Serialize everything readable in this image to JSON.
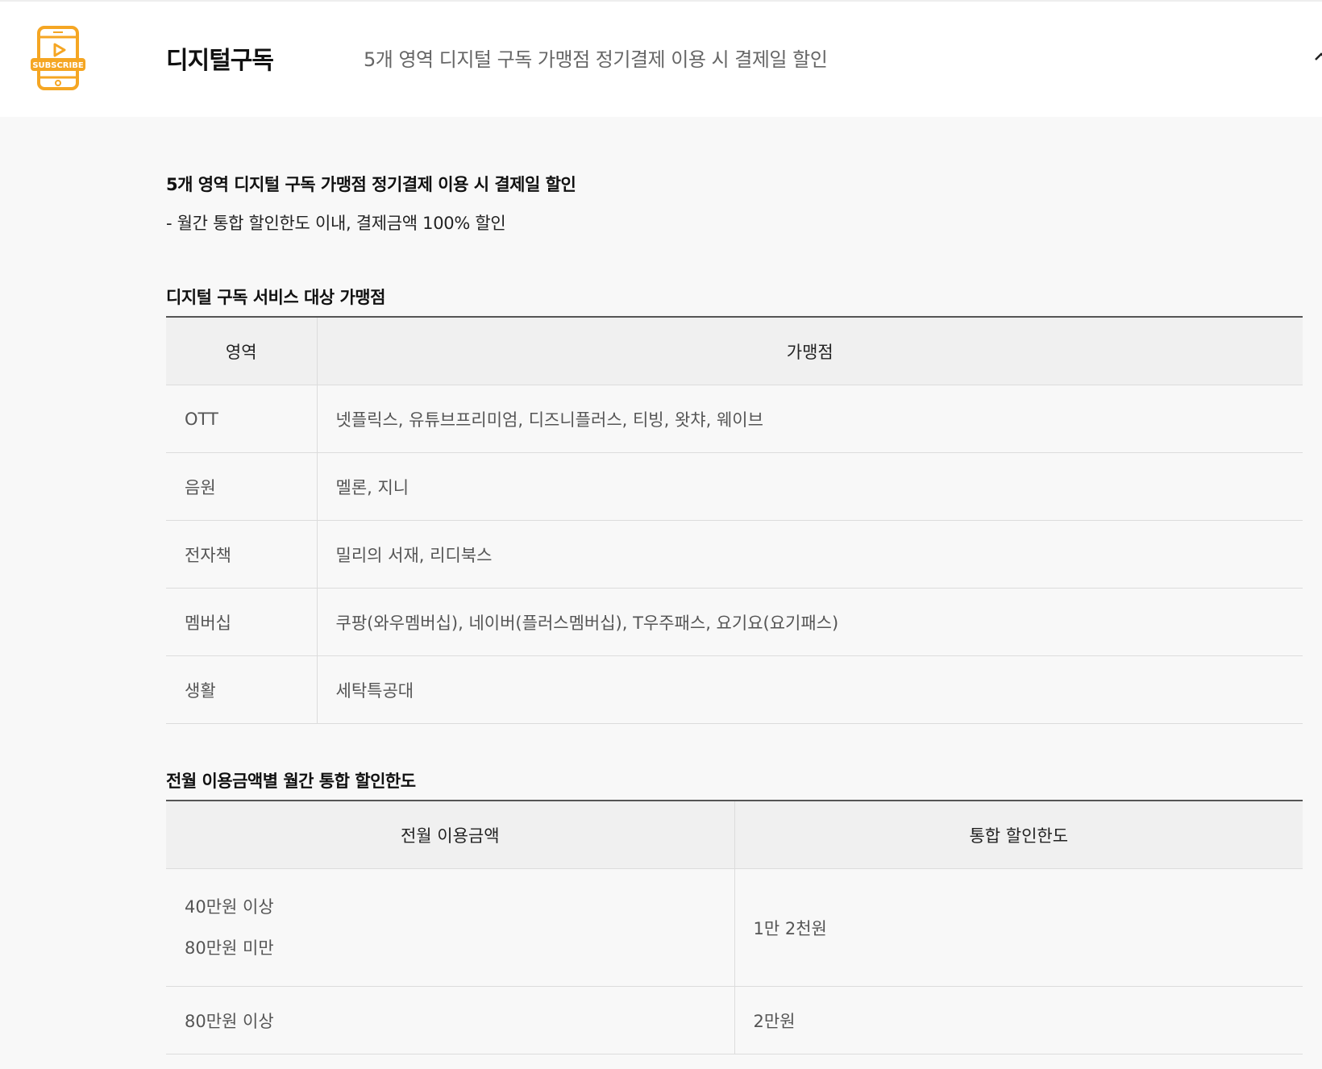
{
  "header": {
    "title": "디지털구독",
    "description": "5개 영역 디지털 구독 가맹점 정기결제 이용 시 결제일 할인",
    "logo_text": "SUBSCRIBE",
    "logo_icon": "subscribe-phone-icon",
    "collapse_icon": "chevron-up-icon",
    "accent_color": "#f5a623"
  },
  "summary": {
    "title": "5개 영역 디지털 구독 가맹점 정기결제 이용 시 결제일 할인",
    "desc": "- 월간 통합 할인한도 이내, 결제금액 100% 할인"
  },
  "merchants": {
    "title": "디지털 구독 서비스 대상 가맹점",
    "headers": [
      "영역",
      "가맹점"
    ],
    "rows": [
      {
        "area": "OTT",
        "stores": "넷플릭스, 유튜브프리미엄, 디즈니플러스, 티빙, 왓챠, 웨이브"
      },
      {
        "area": "음원",
        "stores": "멜론, 지니"
      },
      {
        "area": "전자책",
        "stores": "밀리의 서재, 리디북스"
      },
      {
        "area": "멤버십",
        "stores": "쿠팡(와우멤버십), 네이버(플러스멤버십), T우주패스, 요기요(요기패스)"
      },
      {
        "area": "생활",
        "stores": "세탁특공대"
      }
    ]
  },
  "limits": {
    "title": "전월 이용금액별 월간 통합 할인한도",
    "headers": [
      "전월 이용금액",
      "통합 할인한도"
    ],
    "rows": [
      {
        "amount_line1": "40만원 이상",
        "amount_line2": "80만원 미만",
        "limit": "1만 2천원"
      },
      {
        "amount_line1": "80만원 이상",
        "limit": "2만원"
      }
    ]
  }
}
